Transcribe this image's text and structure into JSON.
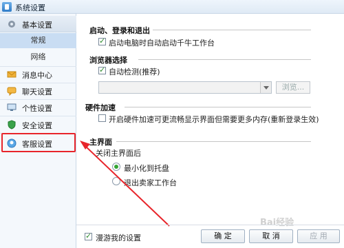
{
  "window": {
    "title": "系统设置"
  },
  "sidebar": {
    "header_label": "基本设置",
    "sub_items": [
      {
        "label": "常规",
        "selected": true
      },
      {
        "label": "网络",
        "selected": false
      }
    ],
    "items": [
      {
        "label": "消息中心",
        "icon": "envelope-icon"
      },
      {
        "label": "聊天设置",
        "icon": "chat-bubble-icon"
      },
      {
        "label": "个性设置",
        "icon": "monitor-icon"
      },
      {
        "label": "安全设置",
        "icon": "shield-icon"
      },
      {
        "label": "客服设置",
        "icon": "headset-icon"
      }
    ]
  },
  "sections": {
    "startup": {
      "title": "启动、登录和退出",
      "auto_start_label": "启动电脑时自动启动千牛工作台",
      "auto_start_checked": true
    },
    "browser": {
      "title": "浏览器选择",
      "auto_detect_label": "自动检测(推荐)",
      "auto_detect_checked": true,
      "browse_label": "浏览..."
    },
    "hardware": {
      "title": "硬件加速",
      "accel_label": "开启硬件加速可更流畅显示界面但需要更多内存(重新登录生效)",
      "accel_checked": false
    },
    "main_ui": {
      "title": "主界面",
      "close_label": "关闭主界面后",
      "options": [
        {
          "label": "最小化到托盘",
          "checked": true
        },
        {
          "label": "退出卖家工作台",
          "checked": false
        }
      ]
    }
  },
  "footer": {
    "roam_label": "漫游我的设置",
    "roam_checked": true,
    "ok_label": "确 定",
    "cancel_label": "取 消",
    "apply_label": "应 用"
  },
  "watermark": "Bai经验",
  "colors": {
    "highlight": "#e8242a",
    "selected": "#c9ddf3"
  }
}
